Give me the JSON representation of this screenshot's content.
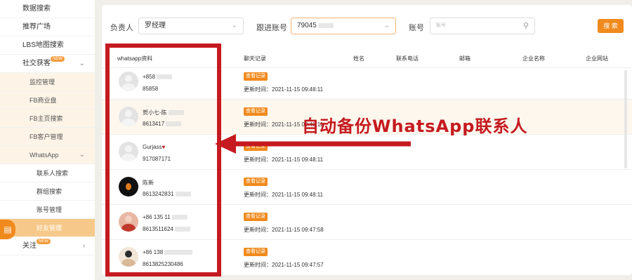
{
  "sidebar": {
    "items": [
      {
        "label": "数据搜索"
      },
      {
        "label": "推荐广场"
      },
      {
        "label": "LBS地图搜索"
      },
      {
        "label": "社交获客",
        "badge": "NEW"
      },
      {
        "label": "监控管理"
      },
      {
        "label": "FB商业盘"
      },
      {
        "label": "FB主页搜索"
      },
      {
        "label": "FB客户管理"
      },
      {
        "label": "WhatsApp"
      },
      {
        "label": "联系人搜索"
      },
      {
        "label": "群组搜索"
      },
      {
        "label": "账号管理"
      },
      {
        "label": "好友管理"
      },
      {
        "label": "关注",
        "badge": "NEW"
      }
    ],
    "float_icon": "chat-icon"
  },
  "filters": {
    "owner_label": "负责人",
    "owner_value": "罗经理",
    "follow_label": "跟进账号",
    "follow_value": "79045",
    "account_label": "账号",
    "account_placeholder": "账号",
    "search_label": "搜 索"
  },
  "table": {
    "headers": [
      "whatsapp资料",
      "聊天记录",
      "姓名",
      "联系电话",
      "邮箱",
      "企业名称",
      "企业网站"
    ],
    "rows": [
      {
        "name": "+858",
        "phone": "85858",
        "btn": "查看记录",
        "updated": "更新时间：2021-11-15 09:48:11"
      },
      {
        "name": "贺小七-陈",
        "phone": "8613417",
        "btn": "查看记录",
        "updated": "更新时间：2021-11-15 09:48:11"
      },
      {
        "name": "Gurjass",
        "phone": "917087171",
        "btn": "查看记录",
        "updated": "更新时间：2021-11-15 09:48:11"
      },
      {
        "name": "陈新",
        "phone": "8613242831",
        "btn": "查看记录",
        "updated": "更新时间：2021-11-15 09:48:11"
      },
      {
        "name": "+86 135 11",
        "phone": "8613511624",
        "btn": "查看记录",
        "updated": "更新时间：2021-11-15 09:47:58"
      },
      {
        "name": "+86 138",
        "phone": "8613825230486",
        "btn": "查看记录",
        "updated": "更新时间：2021-11-15 09:47:57"
      }
    ]
  },
  "annotation": {
    "text": "自动备份WhatsApp联系人",
    "color": "#c51a1f"
  },
  "colors": {
    "accent": "#f08a1d",
    "annotation": "#c51a1f"
  }
}
